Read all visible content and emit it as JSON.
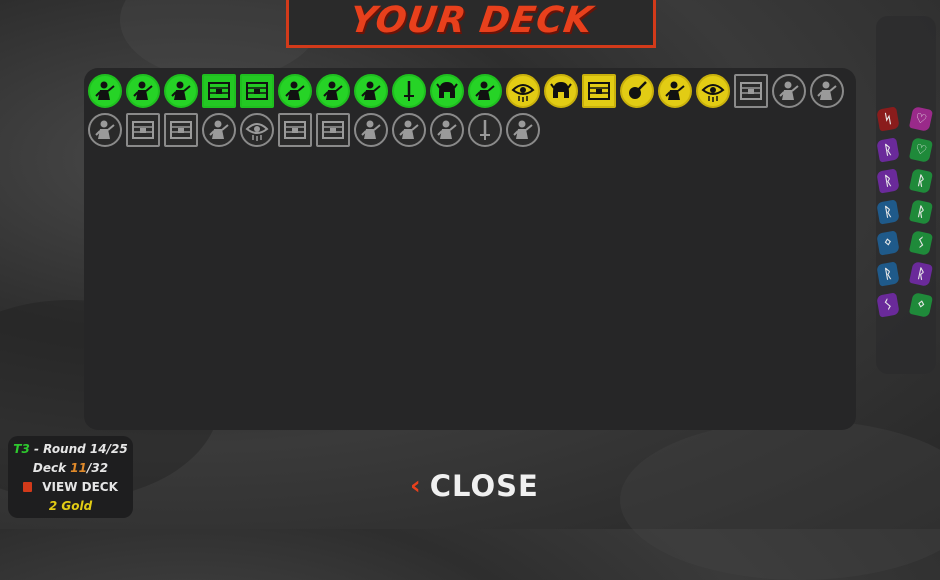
{
  "title": "YOUR DECK",
  "info": {
    "turn": "T3",
    "round_label": "- Round 14/25",
    "deck_label": "Deck",
    "deck_current": "11",
    "deck_total": "/32",
    "view_deck": "VIEW DECK",
    "gold": "2 Gold"
  },
  "close_label": "CLOSE",
  "colors": {
    "green": "#26d326",
    "yellow": "#e2cc14",
    "grey": "#8a8a8a",
    "accent": "#e8401c"
  },
  "cards_row1": [
    {
      "shape": "circle",
      "color": "green",
      "icon": "character-icon"
    },
    {
      "shape": "circle",
      "color": "green",
      "icon": "character-icon"
    },
    {
      "shape": "circle",
      "color": "green",
      "icon": "character-icon"
    },
    {
      "shape": "square",
      "color": "green",
      "icon": "item-chest-icon"
    },
    {
      "shape": "square",
      "color": "green",
      "icon": "item-chest-icon"
    },
    {
      "shape": "circle",
      "color": "green",
      "icon": "character-icon"
    },
    {
      "shape": "circle",
      "color": "green",
      "icon": "character-icon"
    },
    {
      "shape": "circle",
      "color": "green",
      "icon": "character-icon"
    },
    {
      "shape": "circle",
      "color": "green",
      "icon": "sword-icon"
    },
    {
      "shape": "circle",
      "color": "green",
      "icon": "helmet-icon"
    },
    {
      "shape": "circle",
      "color": "green",
      "icon": "character-icon"
    },
    {
      "shape": "circle",
      "color": "yellow",
      "icon": "eye-icon"
    },
    {
      "shape": "circle",
      "color": "yellow",
      "icon": "helmet-icon"
    },
    {
      "shape": "square",
      "color": "yellow",
      "icon": "item-chest-icon"
    },
    {
      "shape": "circle",
      "color": "yellow",
      "icon": "instrument-icon"
    },
    {
      "shape": "circle",
      "color": "yellow",
      "icon": "character-icon"
    },
    {
      "shape": "circle",
      "color": "yellow",
      "icon": "eye-icon"
    },
    {
      "shape": "square",
      "color": "grey",
      "icon": "item-chest-icon"
    },
    {
      "shape": "circle",
      "color": "grey",
      "icon": "character-icon"
    },
    {
      "shape": "circle",
      "color": "grey",
      "icon": "character-icon"
    }
  ],
  "cards_row2": [
    {
      "shape": "circle",
      "color": "grey",
      "icon": "character-icon"
    },
    {
      "shape": "square",
      "color": "grey",
      "icon": "item-chest-icon"
    },
    {
      "shape": "square",
      "color": "grey",
      "icon": "item-chest-icon"
    },
    {
      "shape": "circle",
      "color": "grey",
      "icon": "character-icon"
    },
    {
      "shape": "circle",
      "color": "grey",
      "icon": "eye-icon"
    },
    {
      "shape": "square",
      "color": "grey",
      "icon": "item-chest-icon"
    },
    {
      "shape": "square",
      "color": "grey",
      "icon": "item-chest-icon"
    },
    {
      "shape": "circle",
      "color": "grey",
      "icon": "character-icon"
    },
    {
      "shape": "circle",
      "color": "grey",
      "icon": "character-icon"
    },
    {
      "shape": "circle",
      "color": "grey",
      "icon": "character-icon"
    },
    {
      "shape": "circle",
      "color": "grey",
      "icon": "sword-icon"
    },
    {
      "shape": "circle",
      "color": "grey",
      "icon": "character-icon"
    }
  ],
  "runes": [
    {
      "color": "#8a1c1c",
      "glyph": "ᛋ"
    },
    {
      "color": "#9a2a8a",
      "glyph": "♡"
    },
    {
      "color": "#6a2a9a",
      "glyph": "ᚱ"
    },
    {
      "color": "#1f8a3a",
      "glyph": "♡"
    },
    {
      "color": "#6a2a9a",
      "glyph": "ᚱ"
    },
    {
      "color": "#1f8a3a",
      "glyph": "ᚱ"
    },
    {
      "color": "#1f5a8a",
      "glyph": "ᚱ"
    },
    {
      "color": "#1f8a3a",
      "glyph": "ᚱ"
    },
    {
      "color": "#1f5a8a",
      "glyph": "ᛜ"
    },
    {
      "color": "#1f8a3a",
      "glyph": "ᛊ"
    },
    {
      "color": "#1f5a8a",
      "glyph": "ᚱ"
    },
    {
      "color": "#6a2a9a",
      "glyph": "ᚱ"
    },
    {
      "color": "#6a2a9a",
      "glyph": "ᛊ"
    },
    {
      "color": "#1f8a3a",
      "glyph": "ᛜ"
    }
  ]
}
